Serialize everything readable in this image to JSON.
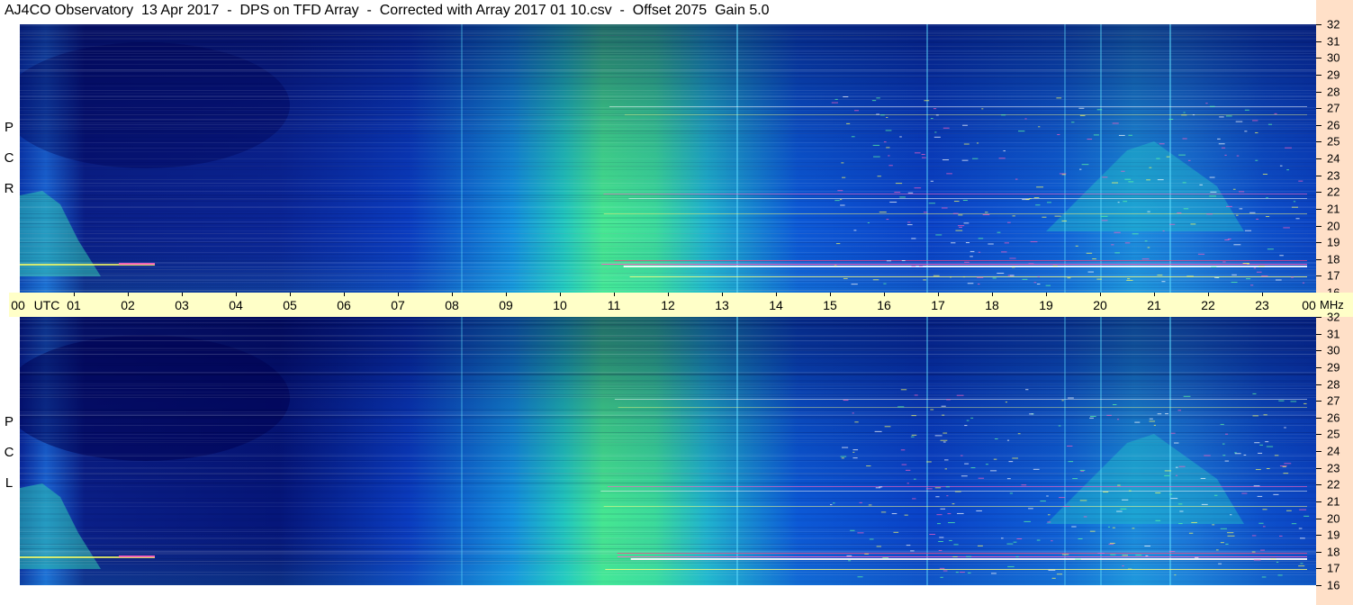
{
  "title": "AJ4CO Observatory  13 Apr 2017  -  DPS on TFD Array  -  Corrected with Array 2017 01 10.csv  -  Offset 2075  Gain 5.0",
  "panels": [
    {
      "id": "rcp",
      "label": [
        "R",
        "C",
        "P"
      ]
    },
    {
      "id": "lcp",
      "label": [
        "L",
        "C",
        "P"
      ]
    }
  ],
  "time_axis": {
    "first_label": "00",
    "utc_label": "UTC",
    "labels": [
      "01",
      "02",
      "03",
      "04",
      "05",
      "06",
      "07",
      "08",
      "09",
      "10",
      "11",
      "12",
      "13",
      "14",
      "15",
      "16",
      "17",
      "18",
      "19",
      "20",
      "21",
      "22",
      "23"
    ],
    "last_label": "00",
    "unit": "MHz"
  },
  "chart_data": {
    "type": "heatmap",
    "title": "AJ4CO Observatory  13 Apr 2017  -  DPS on TFD Array  -  Corrected with Array 2017 01 10.csv  -  Offset 2075  Gain 5.0",
    "x_range": [
      0,
      24
    ],
    "y_range": [
      16,
      32
    ],
    "x_tick_labels": [
      "00",
      "01",
      "02",
      "03",
      "04",
      "05",
      "06",
      "07",
      "08",
      "09",
      "10",
      "11",
      "12",
      "13",
      "14",
      "15",
      "16",
      "17",
      "18",
      "19",
      "20",
      "21",
      "22",
      "23",
      "00"
    ],
    "y_tick_labels": [
      "16",
      "17",
      "18",
      "19",
      "20",
      "21",
      "22",
      "23",
      "24",
      "25",
      "26",
      "27",
      "28",
      "29",
      "30",
      "31",
      "32"
    ],
    "series": [
      {
        "name": "RCP"
      },
      {
        "name": "LCP"
      }
    ],
    "colors": {
      "low": "#00106a",
      "mid": "#0a64dc",
      "high": "#32dc96",
      "peak": "#ffffff",
      "interference": "#ff60c0"
    }
  }
}
